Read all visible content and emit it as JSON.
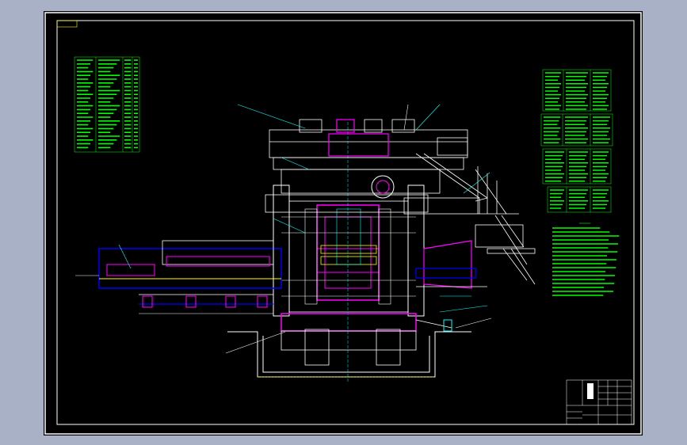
{
  "viewer": {
    "background": "#a9b1c6",
    "sheet_background": "#000000"
  },
  "colors": {
    "frame": "#ffffff",
    "table": "#00ff00",
    "cyan": "#00ffff",
    "magenta": "#ff00ff",
    "blue": "#0000ff",
    "yellow": "#ffff00",
    "red": "#ff0000",
    "white": "#ffffff"
  },
  "drawing": {
    "type": "rolling-mill-stand-assembly",
    "title_block_text": ""
  }
}
